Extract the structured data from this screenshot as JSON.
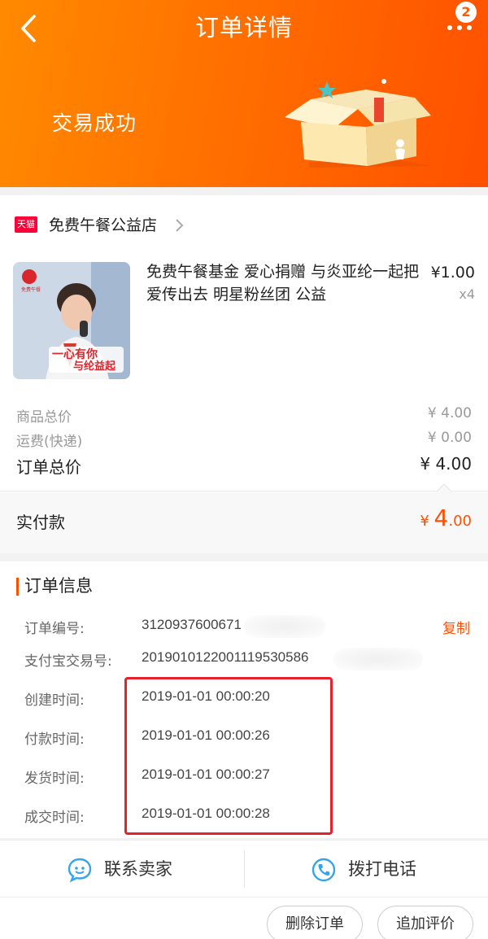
{
  "header": {
    "title": "订单详情",
    "badge_count": "2",
    "status": "交易成功",
    "accent_color": "#ff5a00"
  },
  "store": {
    "platform_badge": "天猫",
    "name": "免费午餐公益店"
  },
  "product": {
    "title": "免费午餐基金 爱心捐赠 与炎亚纶一起把爱传出去 明星粉丝团 公益",
    "price": "¥1.00",
    "quantity": "x4",
    "image_caption_1": "一心有你",
    "image_caption_2": "与纶益起"
  },
  "summary": {
    "goods_total_label": "商品总价",
    "goods_total_value": "¥ 4.00",
    "shipping_label": "运费(快递)",
    "shipping_value": "¥ 0.00",
    "order_total_label": "订单总价",
    "order_total_value": "¥ 4.00",
    "paid_label": "实付款",
    "paid_currency": "¥ ",
    "paid_integer": "4",
    "paid_decimal": ".00"
  },
  "order_info": {
    "title": "订单信息",
    "order_no_label": "订单编号:",
    "order_no_value": "3120937600671",
    "copy_label": "复制",
    "alipay_label": "支付宝交易号:",
    "alipay_value": "20190101220011195305​86",
    "created_label": "创建时间:",
    "created_value": "2019-01-01 00:00:20",
    "paid_time_label": "付款时间:",
    "paid_time_value": "2019-01-01 00:00:26",
    "shipped_label": "发货时间:",
    "shipped_value": "2019-01-01 00:00:27",
    "completed_label": "成交时间:",
    "completed_value": "2019-01-01 00:00:28"
  },
  "contact": {
    "seller_label": "联系卖家",
    "seller_icon": "chat-bubble-icon",
    "phone_label": "拨打电话",
    "phone_icon": "phone-icon"
  },
  "actions": {
    "delete_label": "删除订单",
    "review_label": "追加评价"
  }
}
